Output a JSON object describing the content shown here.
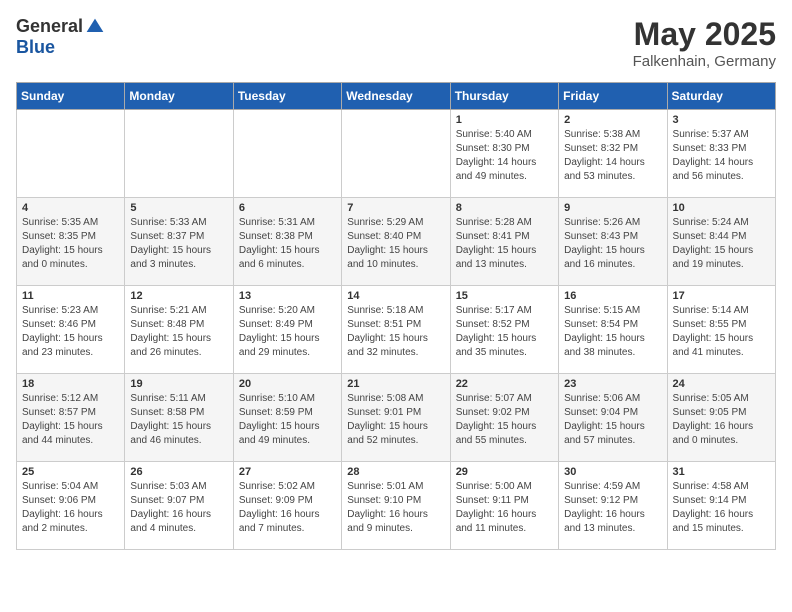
{
  "logo": {
    "general": "General",
    "blue": "Blue"
  },
  "title": "May 2025",
  "location": "Falkenhain, Germany",
  "days_of_week": [
    "Sunday",
    "Monday",
    "Tuesday",
    "Wednesday",
    "Thursday",
    "Friday",
    "Saturday"
  ],
  "weeks": [
    [
      {
        "day": "",
        "info": ""
      },
      {
        "day": "",
        "info": ""
      },
      {
        "day": "",
        "info": ""
      },
      {
        "day": "",
        "info": ""
      },
      {
        "day": "1",
        "info": "Sunrise: 5:40 AM\nSunset: 8:30 PM\nDaylight: 14 hours\nand 49 minutes."
      },
      {
        "day": "2",
        "info": "Sunrise: 5:38 AM\nSunset: 8:32 PM\nDaylight: 14 hours\nand 53 minutes."
      },
      {
        "day": "3",
        "info": "Sunrise: 5:37 AM\nSunset: 8:33 PM\nDaylight: 14 hours\nand 56 minutes."
      }
    ],
    [
      {
        "day": "4",
        "info": "Sunrise: 5:35 AM\nSunset: 8:35 PM\nDaylight: 15 hours\nand 0 minutes."
      },
      {
        "day": "5",
        "info": "Sunrise: 5:33 AM\nSunset: 8:37 PM\nDaylight: 15 hours\nand 3 minutes."
      },
      {
        "day": "6",
        "info": "Sunrise: 5:31 AM\nSunset: 8:38 PM\nDaylight: 15 hours\nand 6 minutes."
      },
      {
        "day": "7",
        "info": "Sunrise: 5:29 AM\nSunset: 8:40 PM\nDaylight: 15 hours\nand 10 minutes."
      },
      {
        "day": "8",
        "info": "Sunrise: 5:28 AM\nSunset: 8:41 PM\nDaylight: 15 hours\nand 13 minutes."
      },
      {
        "day": "9",
        "info": "Sunrise: 5:26 AM\nSunset: 8:43 PM\nDaylight: 15 hours\nand 16 minutes."
      },
      {
        "day": "10",
        "info": "Sunrise: 5:24 AM\nSunset: 8:44 PM\nDaylight: 15 hours\nand 19 minutes."
      }
    ],
    [
      {
        "day": "11",
        "info": "Sunrise: 5:23 AM\nSunset: 8:46 PM\nDaylight: 15 hours\nand 23 minutes."
      },
      {
        "day": "12",
        "info": "Sunrise: 5:21 AM\nSunset: 8:48 PM\nDaylight: 15 hours\nand 26 minutes."
      },
      {
        "day": "13",
        "info": "Sunrise: 5:20 AM\nSunset: 8:49 PM\nDaylight: 15 hours\nand 29 minutes."
      },
      {
        "day": "14",
        "info": "Sunrise: 5:18 AM\nSunset: 8:51 PM\nDaylight: 15 hours\nand 32 minutes."
      },
      {
        "day": "15",
        "info": "Sunrise: 5:17 AM\nSunset: 8:52 PM\nDaylight: 15 hours\nand 35 minutes."
      },
      {
        "day": "16",
        "info": "Sunrise: 5:15 AM\nSunset: 8:54 PM\nDaylight: 15 hours\nand 38 minutes."
      },
      {
        "day": "17",
        "info": "Sunrise: 5:14 AM\nSunset: 8:55 PM\nDaylight: 15 hours\nand 41 minutes."
      }
    ],
    [
      {
        "day": "18",
        "info": "Sunrise: 5:12 AM\nSunset: 8:57 PM\nDaylight: 15 hours\nand 44 minutes."
      },
      {
        "day": "19",
        "info": "Sunrise: 5:11 AM\nSunset: 8:58 PM\nDaylight: 15 hours\nand 46 minutes."
      },
      {
        "day": "20",
        "info": "Sunrise: 5:10 AM\nSunset: 8:59 PM\nDaylight: 15 hours\nand 49 minutes."
      },
      {
        "day": "21",
        "info": "Sunrise: 5:08 AM\nSunset: 9:01 PM\nDaylight: 15 hours\nand 52 minutes."
      },
      {
        "day": "22",
        "info": "Sunrise: 5:07 AM\nSunset: 9:02 PM\nDaylight: 15 hours\nand 55 minutes."
      },
      {
        "day": "23",
        "info": "Sunrise: 5:06 AM\nSunset: 9:04 PM\nDaylight: 15 hours\nand 57 minutes."
      },
      {
        "day": "24",
        "info": "Sunrise: 5:05 AM\nSunset: 9:05 PM\nDaylight: 16 hours\nand 0 minutes."
      }
    ],
    [
      {
        "day": "25",
        "info": "Sunrise: 5:04 AM\nSunset: 9:06 PM\nDaylight: 16 hours\nand 2 minutes."
      },
      {
        "day": "26",
        "info": "Sunrise: 5:03 AM\nSunset: 9:07 PM\nDaylight: 16 hours\nand 4 minutes."
      },
      {
        "day": "27",
        "info": "Sunrise: 5:02 AM\nSunset: 9:09 PM\nDaylight: 16 hours\nand 7 minutes."
      },
      {
        "day": "28",
        "info": "Sunrise: 5:01 AM\nSunset: 9:10 PM\nDaylight: 16 hours\nand 9 minutes."
      },
      {
        "day": "29",
        "info": "Sunrise: 5:00 AM\nSunset: 9:11 PM\nDaylight: 16 hours\nand 11 minutes."
      },
      {
        "day": "30",
        "info": "Sunrise: 4:59 AM\nSunset: 9:12 PM\nDaylight: 16 hours\nand 13 minutes."
      },
      {
        "day": "31",
        "info": "Sunrise: 4:58 AM\nSunset: 9:14 PM\nDaylight: 16 hours\nand 15 minutes."
      }
    ]
  ]
}
